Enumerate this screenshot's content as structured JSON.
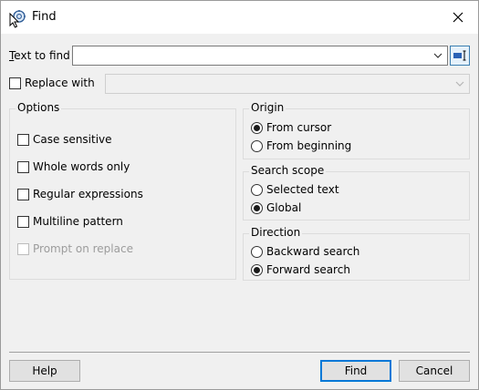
{
  "window": {
    "title": "Find"
  },
  "text_to_find": {
    "label_accel": "T",
    "label_rest": "ext to find",
    "value": ""
  },
  "replace_with": {
    "label": "Replace with",
    "checked": false,
    "value": ""
  },
  "options": {
    "title": "Options",
    "items": [
      {
        "label": "Case sensitive",
        "checked": false,
        "enabled": true
      },
      {
        "label": "Whole words only",
        "checked": false,
        "enabled": true
      },
      {
        "label": "Regular expressions",
        "checked": false,
        "enabled": true
      },
      {
        "label": "Multiline pattern",
        "checked": false,
        "enabled": true
      },
      {
        "label": "Prompt on replace",
        "checked": false,
        "enabled": false
      }
    ]
  },
  "origin": {
    "title": "Origin",
    "items": [
      {
        "label": "From cursor",
        "selected": true
      },
      {
        "label": "From beginning",
        "selected": false
      }
    ]
  },
  "search_scope": {
    "title": "Search scope",
    "items": [
      {
        "label": "Selected text",
        "selected": false
      },
      {
        "label": "Global",
        "selected": true
      }
    ]
  },
  "direction": {
    "title": "Direction",
    "items": [
      {
        "label": "Backward search",
        "selected": false
      },
      {
        "label": "Forward search",
        "selected": true
      }
    ]
  },
  "buttons": {
    "help": "Help",
    "find": "Find",
    "cancel": "Cancel"
  },
  "colors": {
    "accent": "#0078d7",
    "dialog_bg": "#f0f0f0"
  },
  "icons": {
    "app": "find-app-icon",
    "close": "close-icon",
    "dropdown": "chevron-down-icon",
    "side": "text-cursor-icon"
  }
}
